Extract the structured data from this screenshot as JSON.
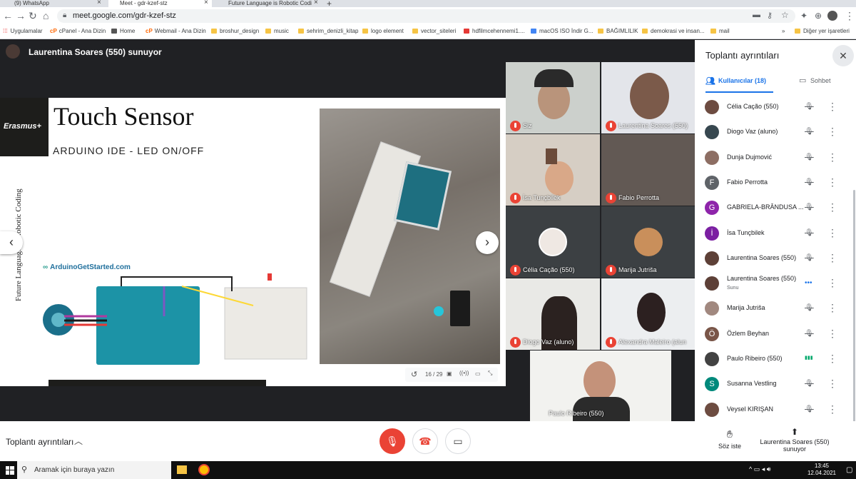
{
  "browser": {
    "tabs": [
      {
        "label": "(9) WhatsApp",
        "active": false
      },
      {
        "label": "Meet - gdr-kzef-stz",
        "active": true
      },
      {
        "label": "Future Language is Robotic Codi",
        "active": false
      }
    ],
    "url": "meet.google.com/gdr-kzef-stz",
    "bookmarks": [
      "Uygulamalar",
      "cPanel - Ana Dizin",
      "Home",
      "Webmail - Ana Dizin",
      "broshur_design",
      "music",
      "sehrim_denizli_kitap",
      "logo element",
      "vector_siteleri",
      "hdfilmcehennemi1....",
      "macOS ISO İndir G...",
      "BAĞIMLILIK",
      "demokrasi ve insan...",
      "mail",
      "Diğer yer işaretleri"
    ]
  },
  "meet": {
    "presenter_title": "Laurentina Soares (550) sunuyor",
    "slide": {
      "logo": "Erasmus+",
      "title": "Touch Sensor",
      "subtitle": "ARDUINO IDE - LED ON/OFF",
      "vertical_text": "Future Language is Robotic Coding",
      "site": "ArduinoGetStarted.com",
      "counter": "16 / 29"
    },
    "tiles": [
      {
        "name": "Siz",
        "muted": true
      },
      {
        "name": "Laurentina Soares (550)",
        "muted": true
      },
      {
        "name": "İsa Tunçbilek",
        "muted": true
      },
      {
        "name": "Fabio Perrotta",
        "muted": true
      },
      {
        "name": "Célia Cação (550)",
        "muted": true
      },
      {
        "name": "Marija Jutriša",
        "muted": true
      },
      {
        "name": "Diogo Vaz (aluno)",
        "muted": true
      },
      {
        "name": "Alexandra Maleiro (alun",
        "muted": true
      },
      {
        "name": "Paulo Ribeiro (550)",
        "muted": false
      }
    ]
  },
  "panel": {
    "title": "Toplantı ayrıntıları",
    "tab_users": "Kullanıcılar (18)",
    "tab_chat": "Sohbet",
    "participants": [
      {
        "name": "Célia Cação (550)",
        "initial": "",
        "color": "#6d4c41",
        "sub": ""
      },
      {
        "name": "Diogo Vaz (aluno)",
        "initial": "",
        "color": "#37474f",
        "sub": ""
      },
      {
        "name": "Dunja Dujmović",
        "initial": "",
        "color": "#8d6e63",
        "sub": ""
      },
      {
        "name": "Fabio Perrotta",
        "initial": "F",
        "color": "#5f6368",
        "sub": ""
      },
      {
        "name": "GABRIELA-BRÂNDUSA ...",
        "initial": "G",
        "color": "#8e24aa",
        "sub": ""
      },
      {
        "name": "İsa Tunçbilek",
        "initial": "İ",
        "color": "#7b1fa2",
        "sub": ""
      },
      {
        "name": "Laurentina Soares (550)",
        "initial": "",
        "color": "#5d4037",
        "sub": ""
      },
      {
        "name": "Laurentina Soares (550)",
        "initial": "",
        "color": "#5d4037",
        "sub": "Sunu"
      },
      {
        "name": "Marija Jutriša",
        "initial": "",
        "color": "#a1887f",
        "sub": ""
      },
      {
        "name": "Özlem Beyhan",
        "initial": "Ö",
        "color": "#795548",
        "sub": ""
      },
      {
        "name": "Paulo Ribeiro (550)",
        "initial": "",
        "color": "#424242",
        "sub": ""
      },
      {
        "name": "Susanna Vestling",
        "initial": "S",
        "color": "#00897b",
        "sub": ""
      },
      {
        "name": "Veysel KIRIŞAN",
        "initial": "",
        "color": "#6d4c41",
        "sub": ""
      }
    ]
  },
  "bottombar": {
    "details": "Toplantı ayrıntıları",
    "raise_hand": "Söz iste",
    "present_line1": "Laurentina Soares (550)",
    "present_line2": "sunuyor"
  },
  "taskbar": {
    "search_placeholder": "Aramak için buraya yazın",
    "time": "13:45",
    "date": "12.04.2021"
  }
}
